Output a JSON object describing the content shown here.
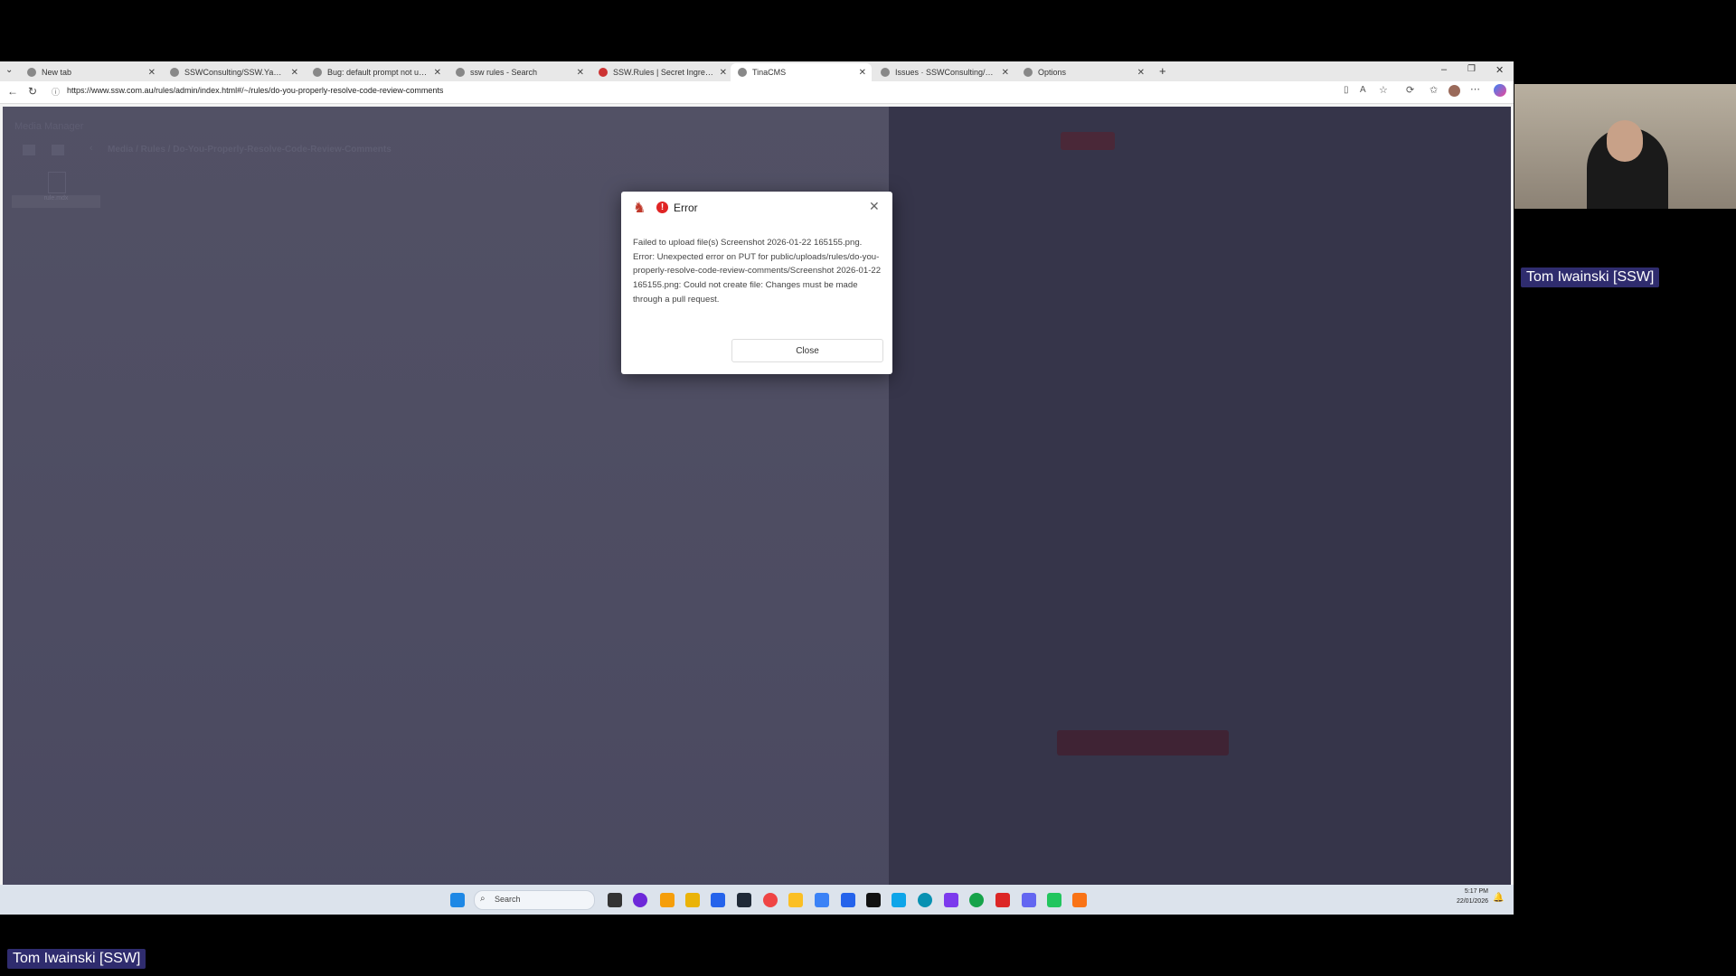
{
  "browser": {
    "tabs": [
      {
        "label": "New tab",
        "active": false
      },
      {
        "label": "SSWConsulting/SSW.YakShaver.D",
        "active": false
      },
      {
        "label": "Bug: default prompt not using",
        "active": false
      },
      {
        "label": "ssw rules - Search",
        "active": false
      },
      {
        "label": "SSW.Rules | Secret Ingredients fo",
        "active": false
      },
      {
        "label": "TinaCMS",
        "active": true
      },
      {
        "label": "Issues · SSWConsulting/SSW.Rul",
        "active": false
      },
      {
        "label": "Options",
        "active": false
      }
    ],
    "url": "https://www.ssw.com.au/rules/admin/index.html#/~/rules/do-you-properly-resolve-code-review-comments"
  },
  "page": {
    "header": "Media Manager",
    "breadcrumb": "Media / Rules / Do-You-Properly-Resolve-Code-Review-Comments",
    "tile_label": "rule.mdx"
  },
  "dialog": {
    "title": "Error",
    "message": "Failed to upload file(s) Screenshot 2026-01-22 165155.png. Error: Unexpected error on PUT for public/uploads/rules/do-you-properly-resolve-code-review-comments/Screenshot 2026-01-22 165155.png: Could not create file: Changes must be made through a pull request.",
    "close_label": "Close"
  },
  "taskbar": {
    "search_placeholder": "Search",
    "time": "5:17 PM",
    "date": "22/01/2026"
  },
  "participants": {
    "webcam_name": "Tom Iwainski [SSW]",
    "bottom_name": "Tom Iwainski [SSW]"
  }
}
